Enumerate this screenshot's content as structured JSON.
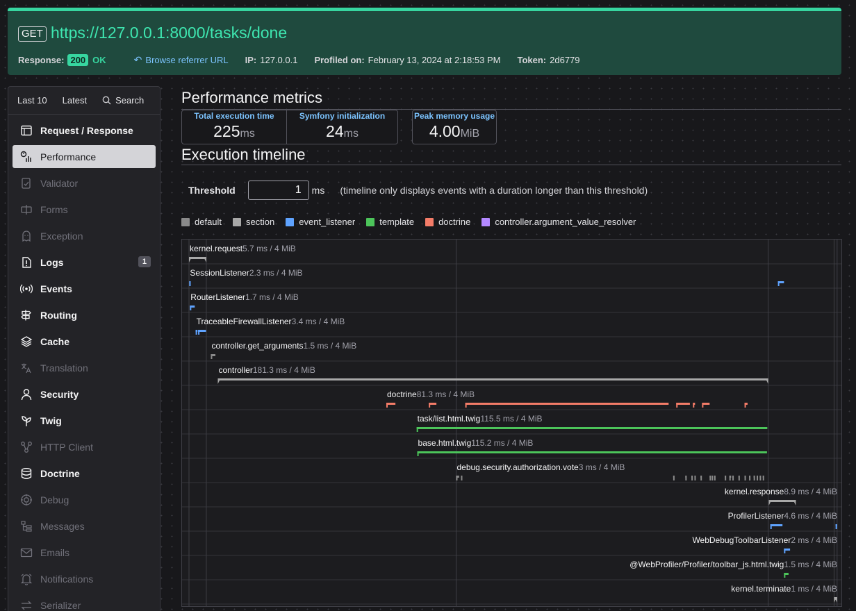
{
  "header": {
    "method": "GET",
    "url": "https://127.0.0.1:8000/tasks/done",
    "response_label": "Response:",
    "status_code": "200",
    "status_text": "OK",
    "referrer_label": "Browse referrer URL",
    "ip_label": "IP:",
    "ip": "127.0.0.1",
    "profiled_label": "Profiled on:",
    "profiled_on": "February 13, 2024 at 2:18:53 PM",
    "token_label": "Token:",
    "token": "2d6779"
  },
  "sidebar": {
    "tabs": [
      "Last 10",
      "Latest",
      "Search"
    ],
    "items": [
      {
        "label": "Request / Response",
        "icon": "request-icon",
        "state": "enabled"
      },
      {
        "label": "Performance",
        "icon": "performance-icon",
        "state": "active"
      },
      {
        "label": "Validator",
        "icon": "validator-icon",
        "state": "disabled"
      },
      {
        "label": "Forms",
        "icon": "forms-icon",
        "state": "disabled"
      },
      {
        "label": "Exception",
        "icon": "exception-icon",
        "state": "disabled"
      },
      {
        "label": "Logs",
        "icon": "logs-icon",
        "state": "enabled",
        "badge": "1"
      },
      {
        "label": "Events",
        "icon": "events-icon",
        "state": "enabled"
      },
      {
        "label": "Routing",
        "icon": "routing-icon",
        "state": "enabled"
      },
      {
        "label": "Cache",
        "icon": "cache-icon",
        "state": "enabled"
      },
      {
        "label": "Translation",
        "icon": "translation-icon",
        "state": "disabled"
      },
      {
        "label": "Security",
        "icon": "security-icon",
        "state": "enabled"
      },
      {
        "label": "Twig",
        "icon": "twig-icon",
        "state": "enabled"
      },
      {
        "label": "HTTP Client",
        "icon": "http-client-icon",
        "state": "disabled"
      },
      {
        "label": "Doctrine",
        "icon": "doctrine-icon",
        "state": "enabled"
      },
      {
        "label": "Debug",
        "icon": "debug-icon",
        "state": "disabled"
      },
      {
        "label": "Messages",
        "icon": "messages-icon",
        "state": "disabled"
      },
      {
        "label": "Emails",
        "icon": "emails-icon",
        "state": "disabled"
      },
      {
        "label": "Notifications",
        "icon": "notifications-icon",
        "state": "disabled"
      },
      {
        "label": "Serializer",
        "icon": "serializer-icon",
        "state": "disabled"
      }
    ]
  },
  "metrics": {
    "title": "Performance metrics",
    "total_label": "Total execution time",
    "total_value": "225",
    "total_unit": "ms",
    "init_label": "Symfony initialization",
    "init_value": "24",
    "init_unit": "ms",
    "memory_label": "Peak memory usage",
    "memory_value": "4.00",
    "memory_unit": "MiB"
  },
  "timeline": {
    "title": "Execution timeline",
    "threshold_label": "Threshold",
    "threshold_value": "1",
    "threshold_unit": "ms",
    "threshold_help": "(timeline only displays events with a duration longer than this threshold)",
    "legend": [
      {
        "name": "default",
        "color": "#8a8a8a"
      },
      {
        "name": "section",
        "color": "#a8a8a8"
      },
      {
        "name": "event_listener",
        "color": "#5fa3ff"
      },
      {
        "name": "template",
        "color": "#4cc45a"
      },
      {
        "name": "doctrine",
        "color": "#f47c68"
      },
      {
        "name": "controller.argument_value_resolver",
        "color": "#b388ff"
      }
    ],
    "events": [
      {
        "name": "kernel.request",
        "detail": "5.7 ms / 4 MiB",
        "category": "section",
        "start": 0.0,
        "duration": 5.7,
        "segments": [
          [
            0.0,
            5.7
          ]
        ]
      },
      {
        "name": "SessionListener",
        "detail": "2.3 ms / 4 MiB",
        "category": "event_listener",
        "start": 0.1,
        "duration": 2.3,
        "segments": [
          [
            0.1,
            0.2
          ],
          [
            194.0,
            196.0
          ]
        ]
      },
      {
        "name": "RouterListener",
        "detail": "1.7 ms / 4 MiB",
        "category": "event_listener",
        "start": 0.3,
        "duration": 1.7,
        "segments": [
          [
            0.3,
            1.9
          ]
        ]
      },
      {
        "name": "TraceableFirewallListener",
        "detail": "3.4 ms / 4 MiB",
        "category": "event_listener",
        "start": 2.2,
        "duration": 3.4,
        "segments": [
          [
            2.2,
            2.8
          ],
          [
            3.0,
            5.6
          ]
        ]
      },
      {
        "name": "controller.get_arguments",
        "detail": "1.5 ms / 4 MiB",
        "category": "default",
        "start": 7.2,
        "duration": 1.5,
        "segments": [
          [
            7.2,
            8.7
          ]
        ]
      },
      {
        "name": "controller",
        "detail": "181.3 ms / 4 MiB",
        "category": "section",
        "start": 9.5,
        "duration": 181.3,
        "segments": [
          [
            9.5,
            190.8
          ]
        ]
      },
      {
        "name": "doctrine",
        "detail": "81.3 ms / 4 MiB",
        "category": "doctrine",
        "start": 65.0,
        "duration": 81.3,
        "segments": [
          [
            65.0,
            68.0
          ],
          [
            79.0,
            81.5
          ],
          [
            91.0,
            158.0
          ],
          [
            160.5,
            165.0
          ],
          [
            166.0,
            166.7
          ],
          [
            169.0,
            171.5
          ],
          [
            183.0,
            184.0
          ]
        ]
      },
      {
        "name": "task/list.html.twig",
        "detail": "115.5 ms / 4 MiB",
        "category": "template",
        "start": 75.0,
        "duration": 115.5,
        "segments": [
          [
            75.0,
            190.5
          ]
        ]
      },
      {
        "name": "base.html.twig",
        "detail": "115.2 ms / 4 MiB",
        "category": "template",
        "start": 75.2,
        "duration": 115.2,
        "segments": [
          [
            75.2,
            190.4
          ]
        ]
      },
      {
        "name": "debug.security.authorization.vote",
        "detail": "3 ms / 4 MiB",
        "category": "default",
        "start": 88.0,
        "duration": 3.0,
        "segments": [
          [
            88.0,
            89.0
          ],
          [
            89.6,
            89.8
          ],
          [
            159.5,
            159.7
          ],
          [
            163.5,
            163.7
          ],
          [
            165.5,
            165.7
          ],
          [
            166.5,
            166.7
          ],
          [
            168.5,
            168.7
          ],
          [
            171.5,
            171.7
          ],
          [
            172.2,
            172.4
          ],
          [
            173.0,
            173.2
          ],
          [
            176.5,
            176.7
          ],
          [
            178.0,
            178.6
          ],
          [
            179.0,
            179.2
          ],
          [
            181.0,
            181.2
          ],
          [
            183.0,
            183.2
          ],
          [
            184.5,
            184.7
          ],
          [
            186.0,
            186.2
          ],
          [
            187.0,
            187.2
          ],
          [
            188.0,
            188.2
          ],
          [
            189.0,
            189.2
          ]
        ]
      },
      {
        "name": "kernel.response",
        "detail": "8.9 ms / 4 MiB",
        "category": "section",
        "start": 191.0,
        "duration": 8.9,
        "segments": [
          [
            191.0,
            199.9
          ]
        ]
      },
      {
        "name": "ProfilerListener",
        "detail": "4.6 ms / 4 MiB",
        "category": "event_listener",
        "start": 191.5,
        "duration": 4.6,
        "segments": [
          [
            191.5,
            195.5
          ],
          [
            213.0,
            213.5
          ]
        ]
      },
      {
        "name": "WebDebugToolbarListener",
        "detail": "2 ms / 4 MiB",
        "category": "event_listener",
        "start": 196.0,
        "duration": 2.0,
        "segments": [
          [
            196.0,
            198.0
          ]
        ]
      },
      {
        "name": "@WebProfiler/Profiler/toolbar_js.html.twig",
        "detail": "1.5 ms / 4 MiB",
        "category": "template",
        "start": 196.0,
        "duration": 1.5,
        "segments": [
          [
            196.0,
            197.5
          ]
        ]
      },
      {
        "name": "kernel.terminate",
        "detail": "1 ms / 4 MiB",
        "category": "section",
        "start": 212.5,
        "duration": 1.0,
        "segments": [
          [
            212.5,
            213.5
          ]
        ]
      }
    ],
    "markers": [
      0.0,
      5.7,
      88.0,
      190.8,
      212.5,
      213.5
    ]
  }
}
